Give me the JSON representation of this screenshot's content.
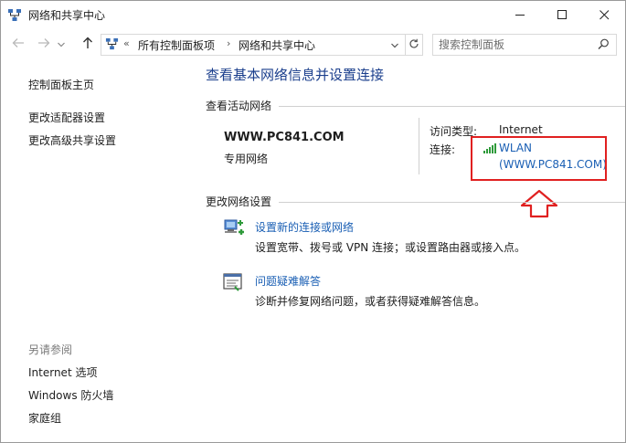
{
  "window": {
    "title": "网络和共享中心"
  },
  "address": {
    "overflow": "«",
    "crumbs": [
      "所有控制面板项",
      "网络和共享中心"
    ],
    "separator": "›"
  },
  "search": {
    "placeholder": "搜索控制面板"
  },
  "sidebar": {
    "home_link": "控制面板主页",
    "links": [
      "更改适配器设置",
      "更改高级共享设置"
    ],
    "see_also_heading": "另请参阅",
    "see_also": [
      "Internet 选项",
      "Windows 防火墙",
      "家庭组"
    ]
  },
  "main": {
    "title": "查看基本网络信息并设置连接",
    "active_networks_header": "查看活动网络",
    "network": {
      "name": "WWW.PC841.COM",
      "type": "专用网络",
      "access_type_label": "访问类型:",
      "access_type_value": "Internet",
      "connections_label": "连接:",
      "connection_line1": "WLAN",
      "connection_line2": "(WWW.PC841.COM)"
    },
    "change_settings_header": "更改网络设置",
    "tasks": [
      {
        "icon": "new-connection-icon",
        "link": "设置新的连接或网络",
        "desc": "设置宽带、拨号或 VPN 连接；或设置路由器或接入点。"
      },
      {
        "icon": "troubleshoot-icon",
        "link": "问题疑难解答",
        "desc": "诊断并修复网络问题，或者获得疑难解答信息。"
      }
    ]
  },
  "colors": {
    "link": "#1a5fb4",
    "title": "#1a3e8c",
    "annotation": "#e02020"
  }
}
